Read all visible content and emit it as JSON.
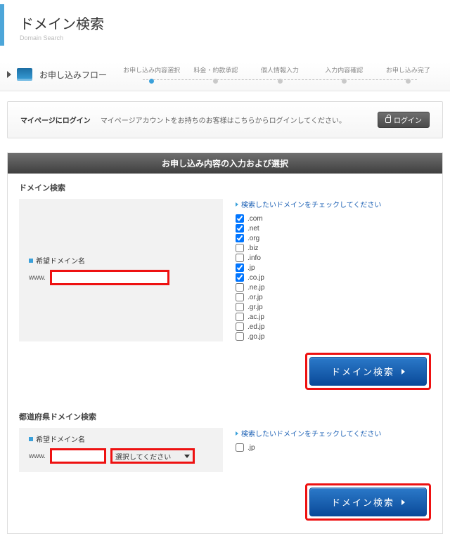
{
  "header": {
    "title": "ドメイン検索",
    "subtitle": "Domain Search"
  },
  "flow": {
    "label": "お申し込みフロー",
    "steps": [
      "お申し込み内容選択",
      "料金・約款承認",
      "個人情報入力",
      "入力内容確認",
      "お申し込み完了"
    ],
    "active_index": 0
  },
  "login_bar": {
    "title": "マイページにログイン",
    "message": "マイページアカウントをお持ちのお客様はこちらからログインしてください。",
    "button": "ログイン"
  },
  "panel": {
    "heading": "お申し込み内容の入力および選択"
  },
  "section_domain": {
    "title": "ドメイン検索",
    "field_label": "希望ドメイン名",
    "prefix": "www.",
    "input_value": "",
    "hint": "検索したいドメインをチェックしてください",
    "tlds": [
      {
        "label": ".com",
        "checked": true
      },
      {
        "label": ".net",
        "checked": true
      },
      {
        "label": ".org",
        "checked": true
      },
      {
        "label": ".biz",
        "checked": false
      },
      {
        "label": ".info",
        "checked": false
      },
      {
        "label": ".jp",
        "checked": true
      },
      {
        "label": ".co.jp",
        "checked": true
      },
      {
        "label": ".ne.jp",
        "checked": false
      },
      {
        "label": ".or.jp",
        "checked": false
      },
      {
        "label": ".gr.jp",
        "checked": false
      },
      {
        "label": ".ac.jp",
        "checked": false
      },
      {
        "label": ".ed.jp",
        "checked": false
      },
      {
        "label": ".go.jp",
        "checked": false
      }
    ],
    "search_button": "ドメイン検索"
  },
  "section_pref": {
    "title": "都道府県ドメイン検索",
    "field_label": "希望ドメイン名",
    "prefix": "www.",
    "input_value": "",
    "select_placeholder": "選択してください",
    "hint": "検索したいドメインをチェックしてください",
    "tlds": [
      {
        "label": ".jp",
        "checked": false
      }
    ],
    "search_button": "ドメイン検索"
  }
}
